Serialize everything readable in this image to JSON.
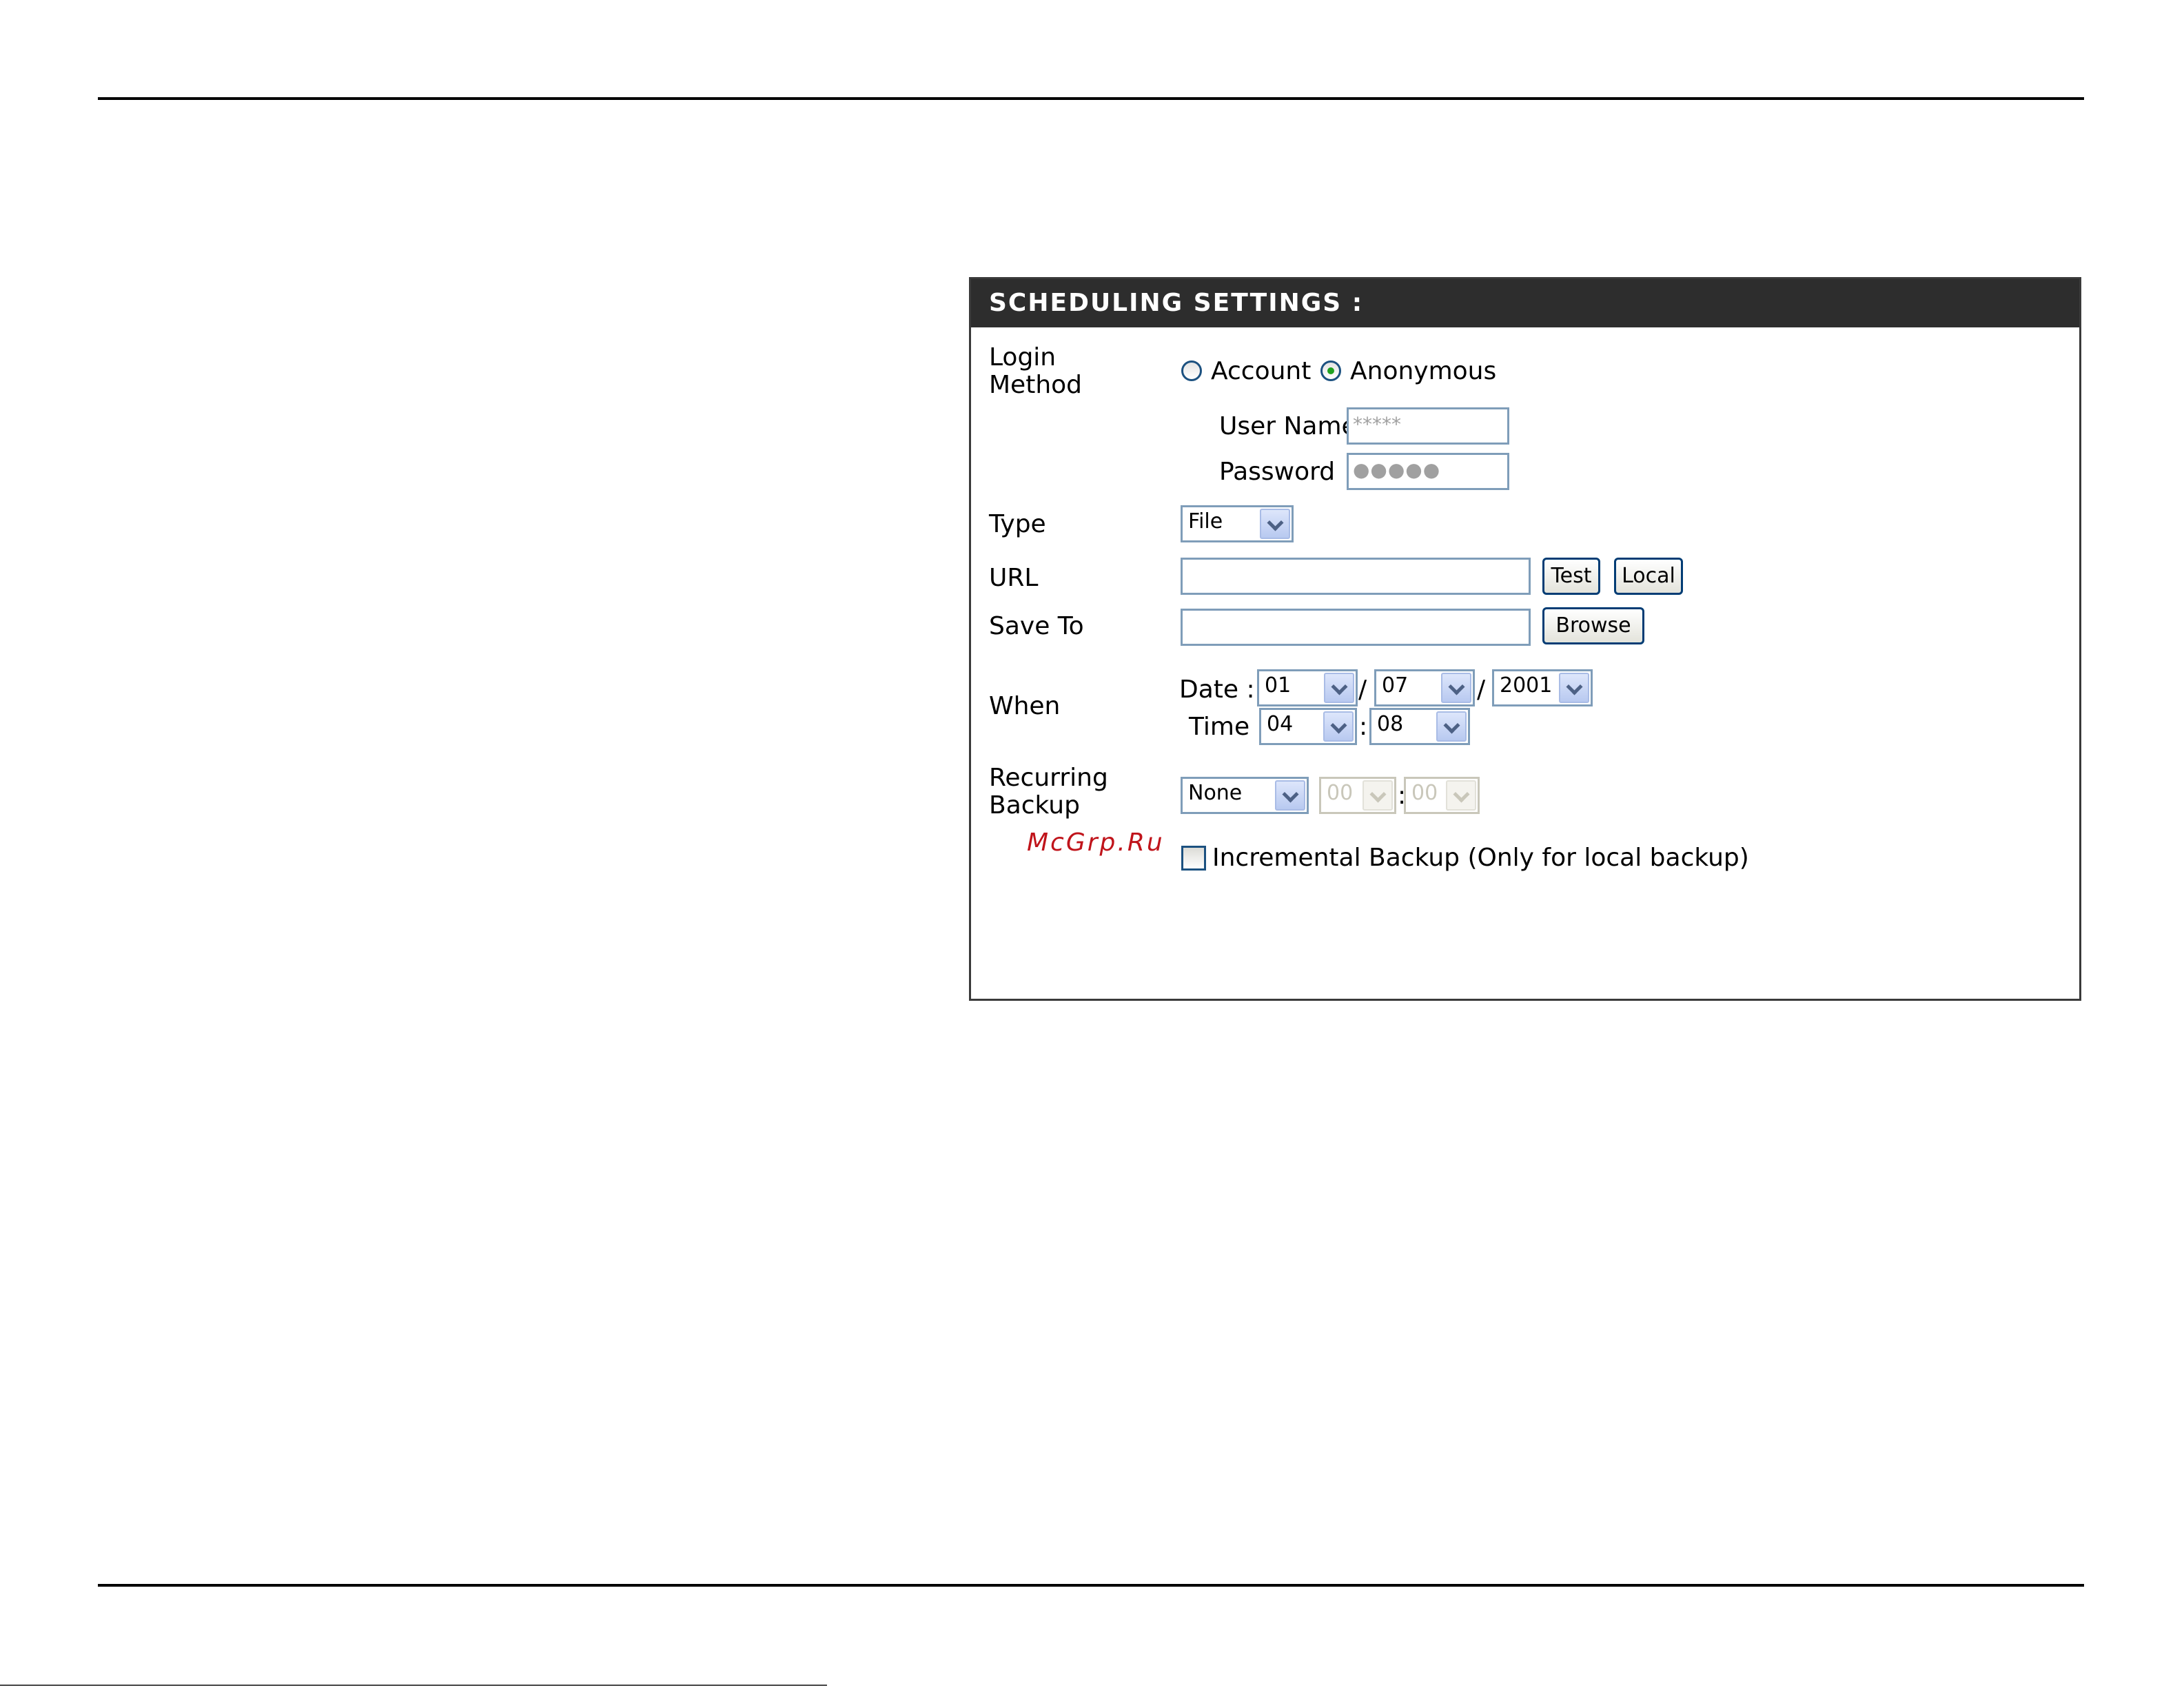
{
  "panel": {
    "title": "SCHEDULING SETTINGS :"
  },
  "login_method": {
    "label_line1": "Login",
    "label_line2": "Method",
    "options": [
      {
        "label": "Account",
        "selected": false
      },
      {
        "label": "Anonymous",
        "selected": true
      }
    ],
    "user_name_label": "User Name",
    "user_name_value": "*****",
    "password_label": "Password",
    "password_value": "●●●●●"
  },
  "type": {
    "label": "Type",
    "selected": "File"
  },
  "url": {
    "label": "URL",
    "value": "",
    "test_button": "Test",
    "local_button": "Local"
  },
  "save_to": {
    "label": "Save To",
    "value": "",
    "browse_button": "Browse"
  },
  "when": {
    "label": "When",
    "date_label": "Date :",
    "month": "01",
    "day": "07",
    "year": "2001",
    "date_sep": "/",
    "time_label": "Time :",
    "hour": "04",
    "minute": "08",
    "time_sep": ":"
  },
  "recurring": {
    "label_line1": "Recurring",
    "label_line2": "Backup",
    "selected": "None",
    "hour": "00",
    "minute": "00",
    "sep": ":"
  },
  "incremental": {
    "label": "Incremental Backup (Only for local backup)",
    "checked": false
  },
  "watermark": "McGrp.Ru"
}
